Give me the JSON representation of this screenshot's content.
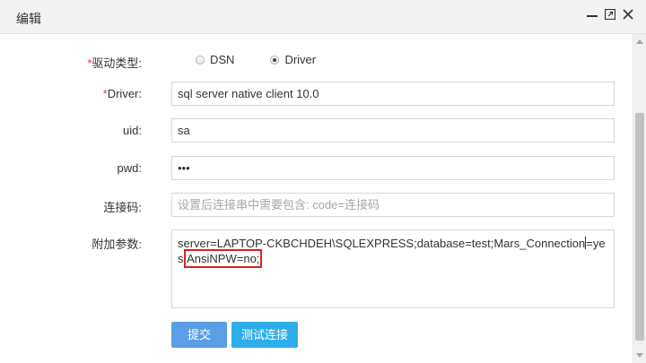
{
  "window": {
    "title": "编辑"
  },
  "form": {
    "driver_type": {
      "label": "驱动类型:",
      "options": [
        "DSN",
        "Driver"
      ],
      "selected": "Driver"
    },
    "driver": {
      "label": "Driver:",
      "value": "sql server native client 10.0"
    },
    "uid": {
      "label": "uid:",
      "value": "sa"
    },
    "pwd": {
      "label": "pwd:",
      "value": "•••"
    },
    "conn_code": {
      "label": "连接码:",
      "placeholder": "设置后连接串中需要包含: code=连接码"
    },
    "extra_params": {
      "label": "附加参数:",
      "value_before_caret": "server=LAPTOP-CKBCHDEH\\SQLEXPRESS;database=test;Mars_Connection",
      "value_after_caret": "=yes;",
      "highlighted": "AnsiNPW=no;"
    }
  },
  "buttons": {
    "submit": "提交",
    "test": "测试连接"
  },
  "colors": {
    "required": "#e4393c",
    "submit_button": "#5a9fe6",
    "test_button": "#2eaee8",
    "highlight_box": "#e02020"
  },
  "icons": [
    "minimize-icon",
    "maximize-icon",
    "close-icon"
  ]
}
